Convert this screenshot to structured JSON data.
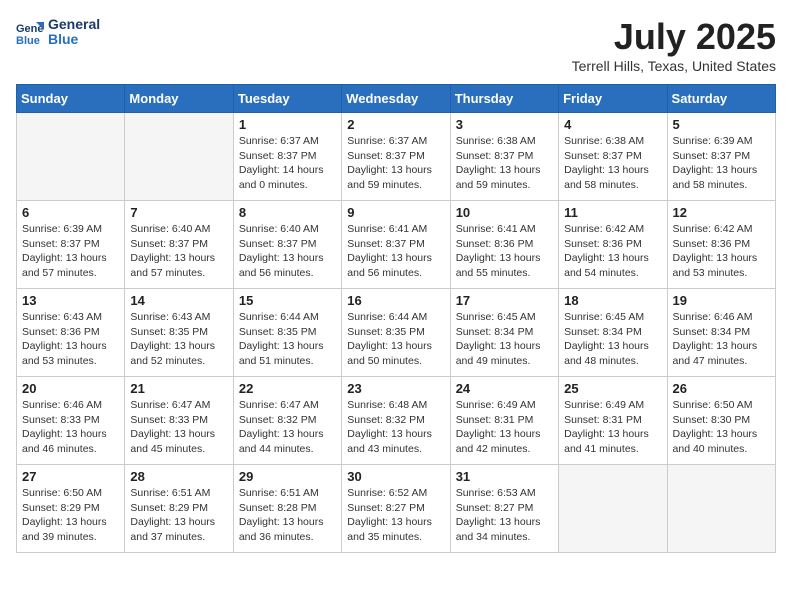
{
  "header": {
    "logo_line1": "General",
    "logo_line2": "Blue",
    "month_year": "July 2025",
    "location": "Terrell Hills, Texas, United States"
  },
  "weekdays": [
    "Sunday",
    "Monday",
    "Tuesday",
    "Wednesday",
    "Thursday",
    "Friday",
    "Saturday"
  ],
  "weeks": [
    [
      {
        "day": "",
        "empty": true
      },
      {
        "day": "",
        "empty": true
      },
      {
        "day": "1",
        "sunrise": "Sunrise: 6:37 AM",
        "sunset": "Sunset: 8:37 PM",
        "daylight": "Daylight: 14 hours and 0 minutes."
      },
      {
        "day": "2",
        "sunrise": "Sunrise: 6:37 AM",
        "sunset": "Sunset: 8:37 PM",
        "daylight": "Daylight: 13 hours and 59 minutes."
      },
      {
        "day": "3",
        "sunrise": "Sunrise: 6:38 AM",
        "sunset": "Sunset: 8:37 PM",
        "daylight": "Daylight: 13 hours and 59 minutes."
      },
      {
        "day": "4",
        "sunrise": "Sunrise: 6:38 AM",
        "sunset": "Sunset: 8:37 PM",
        "daylight": "Daylight: 13 hours and 58 minutes."
      },
      {
        "day": "5",
        "sunrise": "Sunrise: 6:39 AM",
        "sunset": "Sunset: 8:37 PM",
        "daylight": "Daylight: 13 hours and 58 minutes."
      }
    ],
    [
      {
        "day": "6",
        "sunrise": "Sunrise: 6:39 AM",
        "sunset": "Sunset: 8:37 PM",
        "daylight": "Daylight: 13 hours and 57 minutes."
      },
      {
        "day": "7",
        "sunrise": "Sunrise: 6:40 AM",
        "sunset": "Sunset: 8:37 PM",
        "daylight": "Daylight: 13 hours and 57 minutes."
      },
      {
        "day": "8",
        "sunrise": "Sunrise: 6:40 AM",
        "sunset": "Sunset: 8:37 PM",
        "daylight": "Daylight: 13 hours and 56 minutes."
      },
      {
        "day": "9",
        "sunrise": "Sunrise: 6:41 AM",
        "sunset": "Sunset: 8:37 PM",
        "daylight": "Daylight: 13 hours and 56 minutes."
      },
      {
        "day": "10",
        "sunrise": "Sunrise: 6:41 AM",
        "sunset": "Sunset: 8:36 PM",
        "daylight": "Daylight: 13 hours and 55 minutes."
      },
      {
        "day": "11",
        "sunrise": "Sunrise: 6:42 AM",
        "sunset": "Sunset: 8:36 PM",
        "daylight": "Daylight: 13 hours and 54 minutes."
      },
      {
        "day": "12",
        "sunrise": "Sunrise: 6:42 AM",
        "sunset": "Sunset: 8:36 PM",
        "daylight": "Daylight: 13 hours and 53 minutes."
      }
    ],
    [
      {
        "day": "13",
        "sunrise": "Sunrise: 6:43 AM",
        "sunset": "Sunset: 8:36 PM",
        "daylight": "Daylight: 13 hours and 53 minutes."
      },
      {
        "day": "14",
        "sunrise": "Sunrise: 6:43 AM",
        "sunset": "Sunset: 8:35 PM",
        "daylight": "Daylight: 13 hours and 52 minutes."
      },
      {
        "day": "15",
        "sunrise": "Sunrise: 6:44 AM",
        "sunset": "Sunset: 8:35 PM",
        "daylight": "Daylight: 13 hours and 51 minutes."
      },
      {
        "day": "16",
        "sunrise": "Sunrise: 6:44 AM",
        "sunset": "Sunset: 8:35 PM",
        "daylight": "Daylight: 13 hours and 50 minutes."
      },
      {
        "day": "17",
        "sunrise": "Sunrise: 6:45 AM",
        "sunset": "Sunset: 8:34 PM",
        "daylight": "Daylight: 13 hours and 49 minutes."
      },
      {
        "day": "18",
        "sunrise": "Sunrise: 6:45 AM",
        "sunset": "Sunset: 8:34 PM",
        "daylight": "Daylight: 13 hours and 48 minutes."
      },
      {
        "day": "19",
        "sunrise": "Sunrise: 6:46 AM",
        "sunset": "Sunset: 8:34 PM",
        "daylight": "Daylight: 13 hours and 47 minutes."
      }
    ],
    [
      {
        "day": "20",
        "sunrise": "Sunrise: 6:46 AM",
        "sunset": "Sunset: 8:33 PM",
        "daylight": "Daylight: 13 hours and 46 minutes."
      },
      {
        "day": "21",
        "sunrise": "Sunrise: 6:47 AM",
        "sunset": "Sunset: 8:33 PM",
        "daylight": "Daylight: 13 hours and 45 minutes."
      },
      {
        "day": "22",
        "sunrise": "Sunrise: 6:47 AM",
        "sunset": "Sunset: 8:32 PM",
        "daylight": "Daylight: 13 hours and 44 minutes."
      },
      {
        "day": "23",
        "sunrise": "Sunrise: 6:48 AM",
        "sunset": "Sunset: 8:32 PM",
        "daylight": "Daylight: 13 hours and 43 minutes."
      },
      {
        "day": "24",
        "sunrise": "Sunrise: 6:49 AM",
        "sunset": "Sunset: 8:31 PM",
        "daylight": "Daylight: 13 hours and 42 minutes."
      },
      {
        "day": "25",
        "sunrise": "Sunrise: 6:49 AM",
        "sunset": "Sunset: 8:31 PM",
        "daylight": "Daylight: 13 hours and 41 minutes."
      },
      {
        "day": "26",
        "sunrise": "Sunrise: 6:50 AM",
        "sunset": "Sunset: 8:30 PM",
        "daylight": "Daylight: 13 hours and 40 minutes."
      }
    ],
    [
      {
        "day": "27",
        "sunrise": "Sunrise: 6:50 AM",
        "sunset": "Sunset: 8:29 PM",
        "daylight": "Daylight: 13 hours and 39 minutes."
      },
      {
        "day": "28",
        "sunrise": "Sunrise: 6:51 AM",
        "sunset": "Sunset: 8:29 PM",
        "daylight": "Daylight: 13 hours and 37 minutes."
      },
      {
        "day": "29",
        "sunrise": "Sunrise: 6:51 AM",
        "sunset": "Sunset: 8:28 PM",
        "daylight": "Daylight: 13 hours and 36 minutes."
      },
      {
        "day": "30",
        "sunrise": "Sunrise: 6:52 AM",
        "sunset": "Sunset: 8:27 PM",
        "daylight": "Daylight: 13 hours and 35 minutes."
      },
      {
        "day": "31",
        "sunrise": "Sunrise: 6:53 AM",
        "sunset": "Sunset: 8:27 PM",
        "daylight": "Daylight: 13 hours and 34 minutes."
      },
      {
        "day": "",
        "empty": true
      },
      {
        "day": "",
        "empty": true
      }
    ]
  ]
}
